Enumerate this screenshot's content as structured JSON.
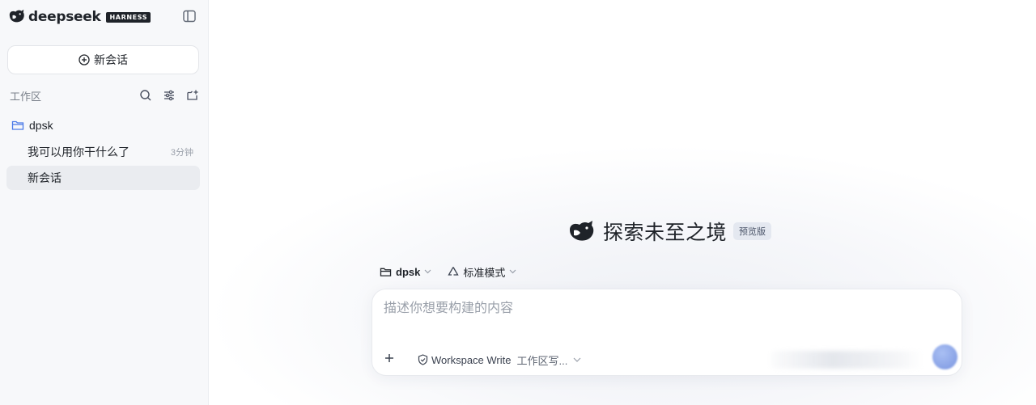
{
  "brand": {
    "name": "deepseek",
    "badge": "HARNESS"
  },
  "sidebar": {
    "new_chat_label": "新会话",
    "workspace_label": "工作区",
    "folder": {
      "name": "dpsk"
    },
    "sessions": [
      {
        "title": "我可以用你干什么了",
        "time": "3分钟"
      },
      {
        "title": "新会话",
        "time": ""
      }
    ]
  },
  "main": {
    "hero_title": "探索未至之境",
    "hero_badge": "预览版",
    "project_selector": "dpsk",
    "mode_selector": "标准模式",
    "input_placeholder": "描述你想要构建的内容",
    "permission": {
      "name": "Workspace Write",
      "desc": "工作区写..."
    }
  },
  "colors": {
    "accent": "#5b8def",
    "send": "#8aa6ea",
    "active_row": "#eaecf0"
  }
}
